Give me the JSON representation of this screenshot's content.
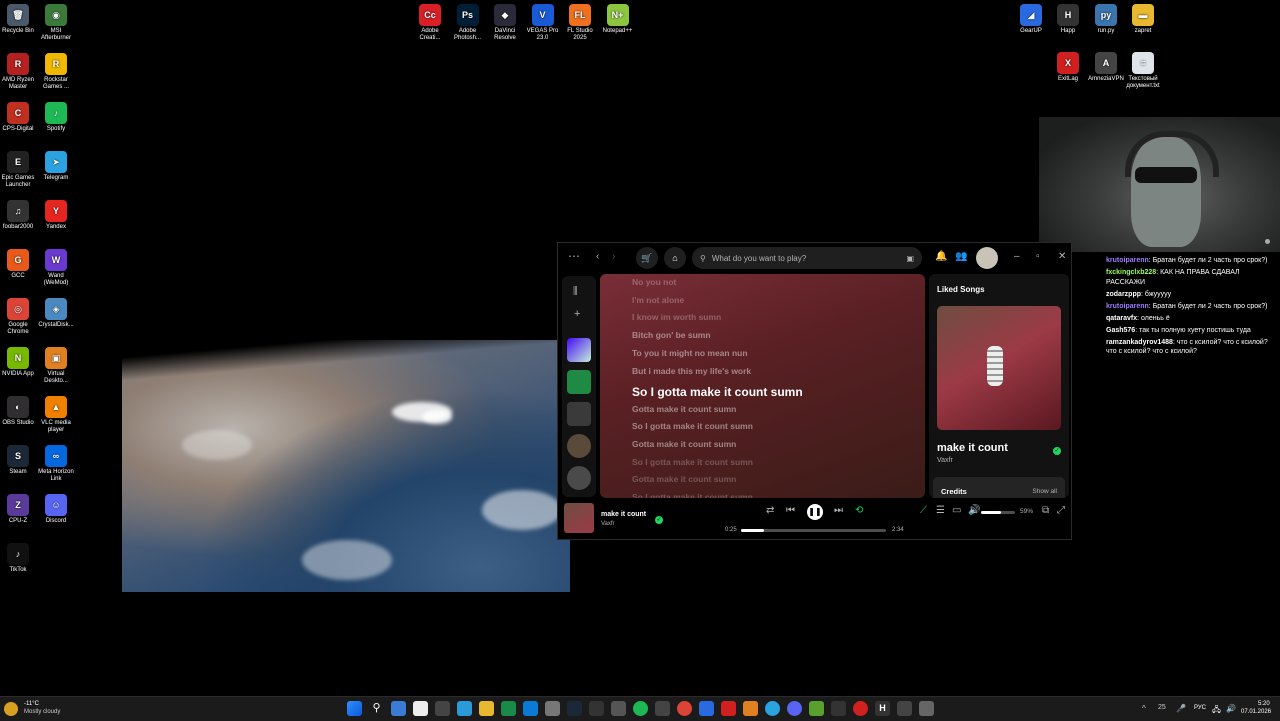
{
  "desktop_left": [
    {
      "label": "Recycle Bin",
      "icon": "recycle-bin-icon",
      "glyph": "🗑",
      "bg": "#4a5a6a"
    },
    {
      "label": "MSI Afterburner",
      "icon": "msi-afterburner-icon",
      "glyph": "◉",
      "bg": "#3b7a3a"
    },
    {
      "label": "AMD Ryzen Master",
      "icon": "amd-ryzen-icon",
      "glyph": "R",
      "bg": "#b52020"
    },
    {
      "label": "Rockstar Games ...",
      "icon": "rockstar-icon",
      "glyph": "R",
      "bg": "#f0b800"
    },
    {
      "label": "CPS-Digital",
      "icon": "cps-digital-icon",
      "glyph": "C",
      "bg": "#c03020"
    },
    {
      "label": "Spotify",
      "icon": "spotify-icon",
      "glyph": "♪",
      "bg": "#1db954"
    },
    {
      "label": "Epic Games Launcher",
      "icon": "epic-games-icon",
      "glyph": "E",
      "bg": "#222"
    },
    {
      "label": "Telegram",
      "icon": "telegram-icon",
      "glyph": "➤",
      "bg": "#2aa3e0"
    },
    {
      "label": "foobar2000",
      "icon": "foobar-icon",
      "glyph": "♫",
      "bg": "#333"
    },
    {
      "label": "Yandex",
      "icon": "yandex-icon",
      "glyph": "Y",
      "bg": "#e52620"
    },
    {
      "label": "GCC",
      "icon": "gcc-icon",
      "glyph": "G",
      "bg": "#e8591a"
    },
    {
      "label": "Wand (WeMod)",
      "icon": "wand-icon",
      "glyph": "W",
      "bg": "#6a3ad0"
    },
    {
      "label": "Google Chrome",
      "icon": "chrome-icon",
      "glyph": "◎",
      "bg": "#db4437"
    },
    {
      "label": "CrystalDisk...",
      "icon": "crystaldisk-icon",
      "glyph": "◈",
      "bg": "#4a8ac0"
    },
    {
      "label": "NVIDIA App",
      "icon": "nvidia-icon",
      "glyph": "N",
      "bg": "#76b900"
    },
    {
      "label": "Virtual Deskto...",
      "icon": "virtual-desktop-icon",
      "glyph": "▣",
      "bg": "#e08020"
    },
    {
      "label": "OBS Studio",
      "icon": "obs-icon",
      "glyph": "◐",
      "bg": "#302e31"
    },
    {
      "label": "VLC media player",
      "icon": "vlc-icon",
      "glyph": "▲",
      "bg": "#f08000"
    },
    {
      "label": "Steam",
      "icon": "steam-icon",
      "glyph": "S",
      "bg": "#1b2838"
    },
    {
      "label": "Meta Horizon Link",
      "icon": "meta-icon",
      "glyph": "∞",
      "bg": "#0668e1"
    },
    {
      "label": "CPU-Z",
      "icon": "cpu-z-icon",
      "glyph": "Z",
      "bg": "#5a3a9a"
    },
    {
      "label": "Discord",
      "icon": "discord-icon",
      "glyph": "☺",
      "bg": "#5865f2"
    },
    {
      "label": "TikTok",
      "icon": "tiktok-icon",
      "glyph": "♪",
      "bg": "#111"
    }
  ],
  "desktop_top": [
    {
      "label": "Adobe Creati...",
      "icon": "adobe-cc-icon",
      "glyph": "Cc",
      "bg": "#da1f26"
    },
    {
      "label": "Adobe Photosh...",
      "icon": "photoshop-icon",
      "glyph": "Ps",
      "bg": "#001e36"
    },
    {
      "label": "DaVinci Resolve",
      "icon": "davinci-icon",
      "glyph": "◆",
      "bg": "#2a2a3a"
    },
    {
      "label": "VEGAS Pro 23.0",
      "icon": "vegas-icon",
      "glyph": "V",
      "bg": "#1a5ad6"
    },
    {
      "label": "FL Studio 2025",
      "icon": "fl-studio-icon",
      "glyph": "FL",
      "bg": "#f07020"
    },
    {
      "label": "Notepad++",
      "icon": "notepadpp-icon",
      "glyph": "N+",
      "bg": "#8cc63f"
    }
  ],
  "desktop_right": [
    {
      "label": "GearUP",
      "icon": "gearup-icon",
      "glyph": "◢",
      "bg": "#2a6ae0"
    },
    {
      "label": "Happ",
      "icon": "happ-icon",
      "glyph": "H",
      "bg": "#333"
    },
    {
      "label": "run.py",
      "icon": "python-file-icon",
      "glyph": "py",
      "bg": "#3a75b0"
    },
    {
      "label": "zapret",
      "icon": "folder-icon",
      "glyph": "▬",
      "bg": "#e8b830"
    },
    {
      "label": "ExitLag",
      "icon": "exitlag-icon",
      "glyph": "X",
      "bg": "#d02020"
    },
    {
      "label": "AmneziaVPN",
      "icon": "amnezia-icon",
      "glyph": "A",
      "bg": "#444"
    },
    {
      "label": "Текстовый документ.txt",
      "icon": "text-file-icon",
      "glyph": "≡",
      "bg": "#dfe4ea"
    }
  ],
  "chat": [
    {
      "user": "krutoiparenn",
      "color": "#9b7cff",
      "text": "Братан будет ли 2 часть про срок?)"
    },
    {
      "user": "fxckingclxb228",
      "color": "#9bff5a",
      "text": "КАК НА ПРАВА СДАВАЛ РАССКАЖИ"
    },
    {
      "user": "zodarzppp",
      "color": "#ffffff",
      "text": "бжууууу"
    },
    {
      "user": "krutoiparenn",
      "color": "#9b7cff",
      "text": "Братан будет ли 2 часть про срок?)"
    },
    {
      "user": "qataravfx",
      "color": "#ffffff",
      "text": "оленьь ё"
    },
    {
      "user": "Gash576",
      "color": "#ffffff",
      "text": "так ты полную хуету постишь туда"
    },
    {
      "user": "ramzankadyrov1488",
      "color": "#ffffff",
      "text": "что с ксилой? что с ксилой? что с ксилой? что с ксилой?"
    }
  ],
  "spotify": {
    "search_placeholder": "What do you want to play?",
    "lyrics": [
      "No you not",
      "I'm not alone",
      "I know im worth sumn",
      "Bitch gon' be sumn",
      "To you it might no mean nun",
      "But i made this my life's work",
      "So I gotta make it count sumn",
      "Gotta make it count sumn",
      "So I gotta make it count sumn",
      "Gotta make it count sumn",
      "So I gotta make it count sumn",
      "Gotta make it count sumn",
      "So I gotta make it count sumn"
    ],
    "active_line": 6,
    "panel_title": "Liked Songs",
    "track_title": "make it count",
    "artist": "Vaxfr",
    "credits_label": "Credits",
    "show_all_label": "Show all",
    "time_current": "0:25",
    "time_total": "2:34",
    "progress": 0.16,
    "volume_label": "59%",
    "volume": 0.59
  },
  "taskbar": {
    "temperature": "-11°C",
    "weather": "Mostly cloudy",
    "tray_num": "25",
    "lang": "РУС",
    "time": "5:20",
    "date": "07.01.2026"
  }
}
